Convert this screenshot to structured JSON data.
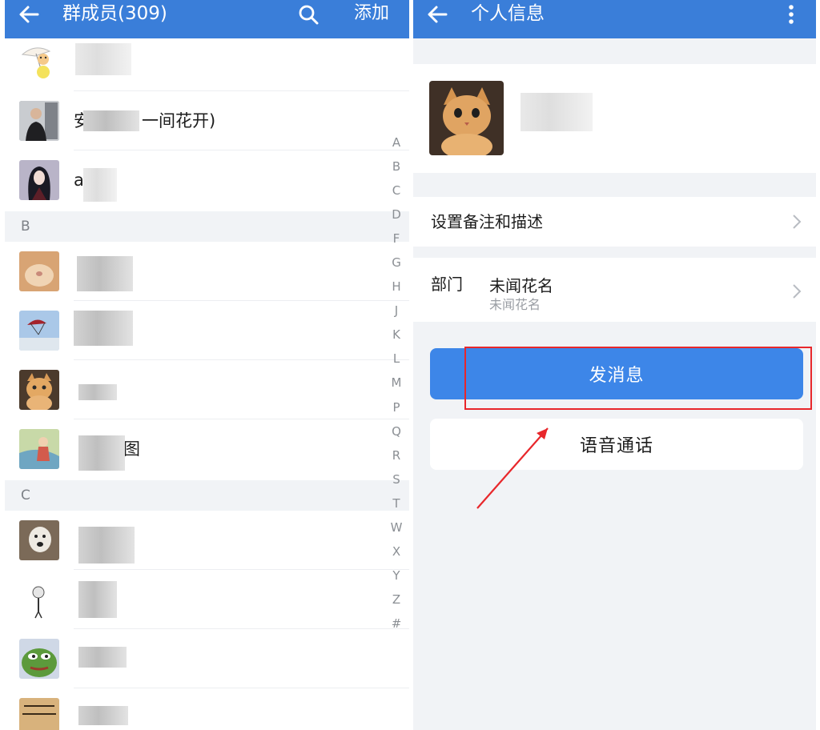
{
  "left": {
    "title": "群成员(309)",
    "add_label": "添加",
    "sections": [
      "B",
      "C"
    ],
    "members": [
      {
        "name_visible": "",
        "avatar": "parasol-cartoon-avatar"
      },
      {
        "name_visible": "安",
        "name_tail": "一间花开)",
        "avatar": "man-selfie-avatar"
      },
      {
        "name_visible": "a",
        "avatar": "anime-girl-avatar"
      },
      {
        "name_visible": "",
        "avatar": "cat-face-closeup-avatar"
      },
      {
        "name_visible": "",
        "avatar": "paraglider-sky-avatar"
      },
      {
        "name_visible": "",
        "avatar": "orange-cat-avatar"
      },
      {
        "name_visible": "",
        "name_tail": "图",
        "avatar": "painting-girl-avatar"
      },
      {
        "name_visible": "",
        "avatar": "dog-avatar"
      },
      {
        "name_visible": "",
        "avatar": "sketch-figure-avatar"
      },
      {
        "name_visible": "",
        "avatar": "pepe-frog-avatar"
      },
      {
        "name_visible": "",
        "avatar": "tiger-avatar"
      }
    ],
    "index_letters": [
      "A",
      "B",
      "C",
      "D",
      "F",
      "G",
      "H",
      "J",
      "K",
      "L",
      "M",
      "P",
      "Q",
      "R",
      "S",
      "T",
      "W",
      "X",
      "Y",
      "Z",
      "#"
    ]
  },
  "right": {
    "title": "个人信息",
    "remark_label": "设置备注和描述",
    "dept_label": "部门",
    "dept_value": "未闻花名",
    "dept_sub": "未闻花名",
    "send_label": "发消息",
    "voice_label": "语音通话"
  },
  "colors": {
    "header": "#3a7ed9",
    "send_button": "#3d86e8",
    "highlight": "#e8272b",
    "background": "#f1f3f6"
  }
}
